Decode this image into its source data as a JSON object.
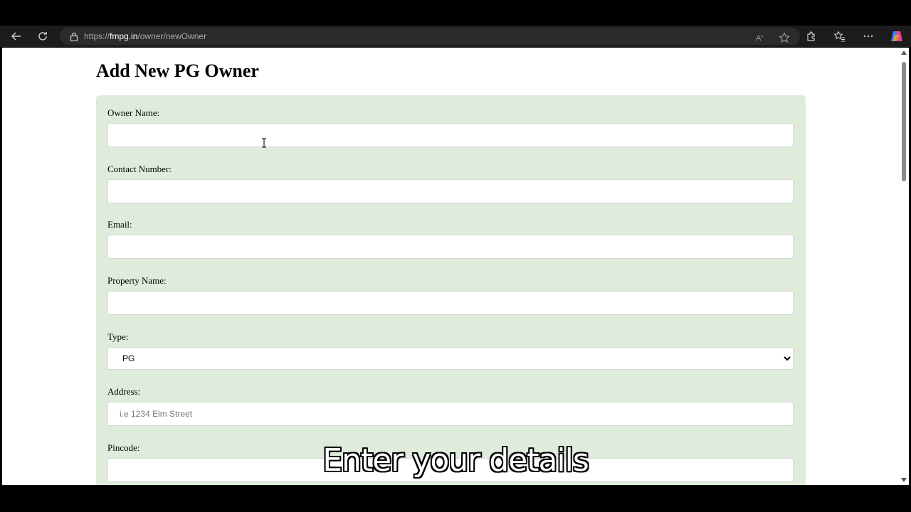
{
  "browser": {
    "url_scheme": "https://",
    "url_host": "fmpg.in",
    "url_path": "/owner/newOwner"
  },
  "page": {
    "title": "Add New PG Owner"
  },
  "form": {
    "owner_name": {
      "label": "Owner Name:",
      "value": "",
      "placeholder": ""
    },
    "contact_number": {
      "label": "Contact Number:",
      "value": "",
      "placeholder": ""
    },
    "email": {
      "label": "Email:",
      "value": "",
      "placeholder": ""
    },
    "property_name": {
      "label": "Property Name:",
      "value": "",
      "placeholder": ""
    },
    "type": {
      "label": "Type:",
      "selected": "PG"
    },
    "address": {
      "label": "Address:",
      "value": "",
      "placeholder": "i.e 1234 Elm Street"
    },
    "pincode": {
      "label": "Pincode:",
      "value": "",
      "placeholder": ""
    }
  },
  "overlay": {
    "caption": "Enter your details"
  },
  "icons": {
    "back": "back-arrow-icon",
    "refresh": "refresh-icon",
    "lock": "lock-icon",
    "read_aloud": "read-aloud-icon",
    "favorite": "star-icon",
    "extensions": "puzzle-icon",
    "favorites": "favorites-icon",
    "more": "more-icon",
    "copilot": "copilot-icon"
  }
}
